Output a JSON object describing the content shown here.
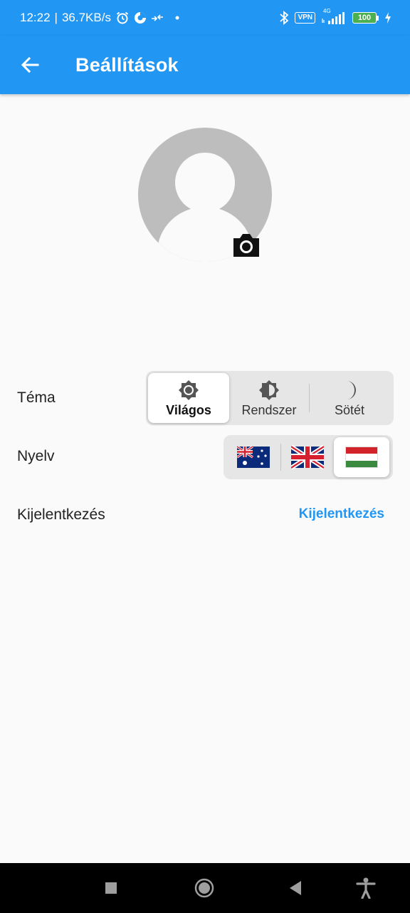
{
  "status_bar": {
    "time": "12:22",
    "speed": "36.7KB/s",
    "vpn_label": "VPN",
    "network_label": "4G",
    "battery_level": "100",
    "icons": [
      "alarm-icon",
      "data-saver-icon",
      "sync-icon",
      "dot-icon",
      "bluetooth-icon",
      "vpn-icon",
      "signal-icon",
      "battery-icon",
      "charging-icon"
    ]
  },
  "app_bar": {
    "title": "Beállítások",
    "back_icon": "arrow-back-icon"
  },
  "profile": {
    "avatar_icon": "default-avatar-icon",
    "camera_icon": "camera-icon"
  },
  "theme": {
    "label": "Téma",
    "options": [
      {
        "label": "Világos",
        "icon": "sun-icon",
        "selected": true
      },
      {
        "label": "Rendszer",
        "icon": "auto-brightness-icon",
        "selected": false
      },
      {
        "label": "Sötét",
        "icon": "moon-icon",
        "selected": false
      }
    ]
  },
  "language": {
    "label": "Nyelv",
    "options": [
      {
        "icon": "flag-australia-icon",
        "selected": false
      },
      {
        "icon": "flag-uk-icon",
        "selected": false
      },
      {
        "icon": "flag-hungary-icon",
        "selected": true
      }
    ]
  },
  "logout": {
    "label": "Kijelentkezés",
    "action_label": "Kijelentkezés"
  },
  "nav_bar": {
    "icons": [
      "recents-square-icon",
      "home-circle-icon",
      "back-triangle-icon",
      "accessibility-icon"
    ]
  },
  "colors": {
    "primary": "#2196f3",
    "selected_segment": "#ffffff",
    "segment_bg": "#e6e6e6"
  }
}
